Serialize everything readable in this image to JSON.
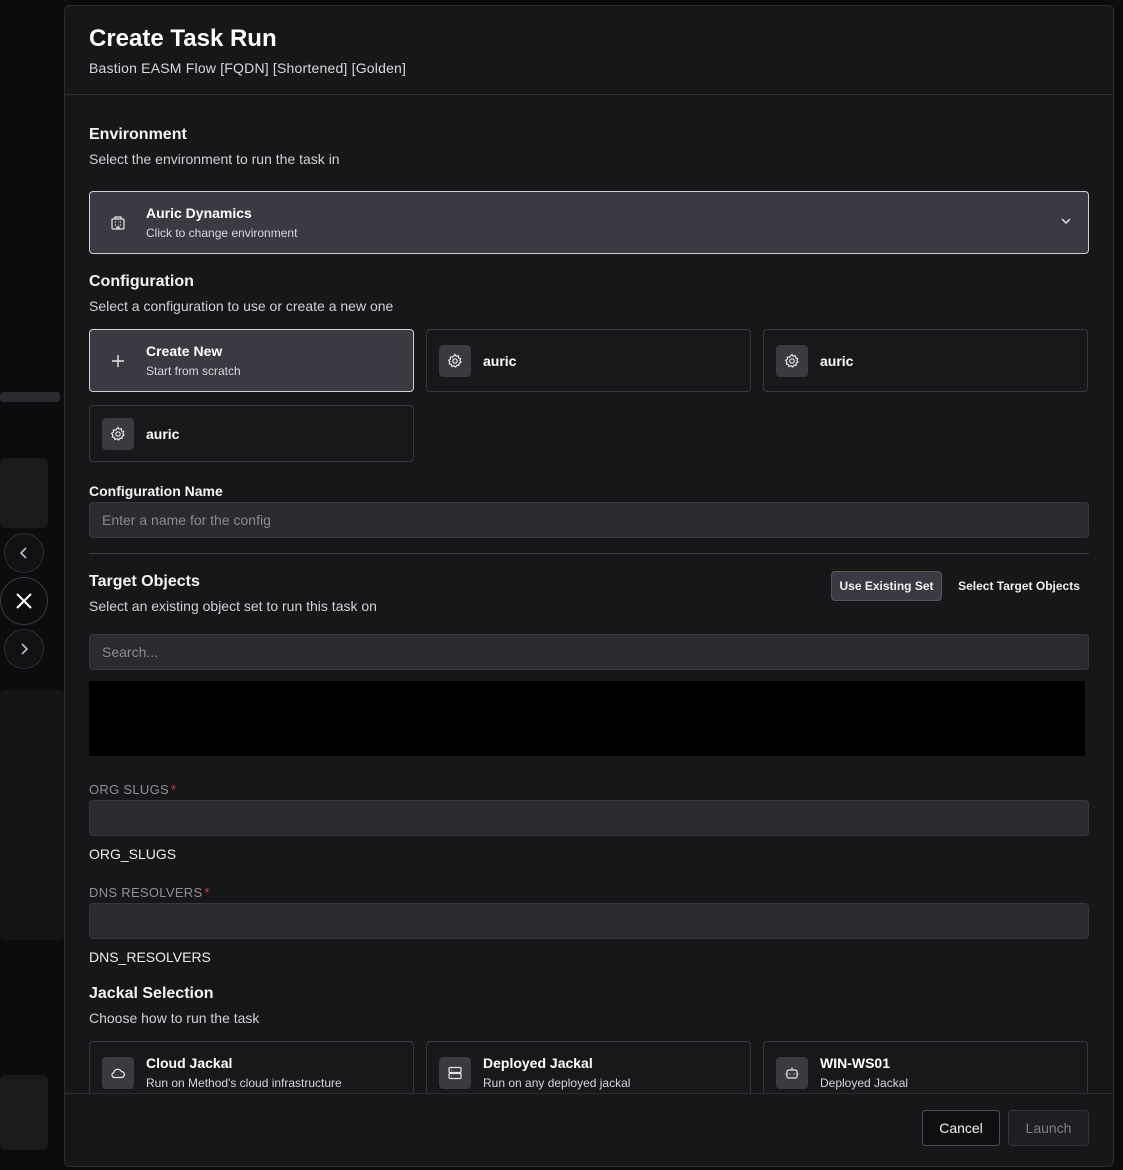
{
  "modal": {
    "title": "Create Task Run",
    "subtitle": "Bastion EASM Flow [FQDN] [Shortened] [Golden]"
  },
  "environment": {
    "title": "Environment",
    "description": "Select the environment to run the task in",
    "selected_name": "Auric Dynamics",
    "selected_hint": "Click to change environment",
    "icon": "building-icon"
  },
  "configuration": {
    "title": "Configuration",
    "description": "Select a configuration to use or create a new one",
    "create_new": {
      "label": "Create New",
      "hint": "Start from scratch",
      "icon": "plus-icon"
    },
    "items": [
      {
        "label": "auric",
        "icon": "gear-icon"
      },
      {
        "label": "auric",
        "icon": "gear-icon"
      },
      {
        "label": "auric",
        "icon": "gear-icon"
      }
    ],
    "name_label": "Configuration Name",
    "name_placeholder": "Enter a name for the config"
  },
  "targets": {
    "title": "Target Objects",
    "description": "Select an existing object set to run this task on",
    "use_existing_label": "Use Existing Set",
    "select_targets_label": "Select Target Objects",
    "search_placeholder": "Search..."
  },
  "params": [
    {
      "label": "ORG SLUGS",
      "required": "*",
      "key": "ORG_SLUGS",
      "value": ""
    },
    {
      "label": "DNS RESOLVERS",
      "required": "*",
      "key": "DNS_RESOLVERS",
      "value": ""
    }
  ],
  "jackal": {
    "title": "Jackal Selection",
    "description": "Choose how to run the task",
    "options": [
      {
        "label": "Cloud Jackal",
        "hint": "Run on Method's cloud infrastructure",
        "icon": "cloud-icon"
      },
      {
        "label": "Deployed Jackal",
        "hint": "Run on any deployed jackal",
        "icon": "server-icon"
      },
      {
        "label": "WIN-WS01",
        "hint": "Deployed Jackal",
        "icon": "robot-icon"
      }
    ]
  },
  "footer": {
    "cancel_label": "Cancel",
    "launch_label": "Launch"
  },
  "colors": {
    "modal_bg": "#17171a",
    "selected_bg": "#3a3a42",
    "required": "#e0364a"
  }
}
